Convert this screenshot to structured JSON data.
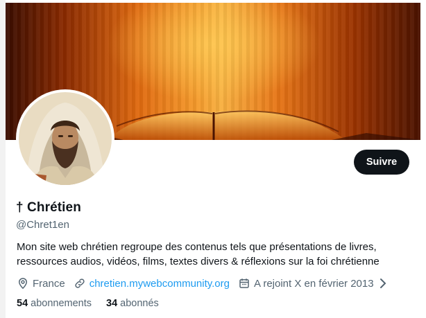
{
  "profile": {
    "name": "† Chrétien",
    "handle": "@Chret1en",
    "bio_lines": [
      "Mon site web chrétien regroupe des contenus tels que présentations de livres,",
      "ressources audios, vidéos, films, textes divers & réflexions sur la foi chrétienne"
    ],
    "location": "France",
    "website": "chretien.mywebcommunity.org",
    "joined": "A rejoint X en février 2013",
    "following_count": "54",
    "following_label": "abonnements",
    "followers_count": "34",
    "followers_label": "abonnés"
  },
  "actions": {
    "follow_label": "Suivre"
  },
  "icons": {
    "location": "location-pin-icon",
    "website": "link-icon",
    "joined": "calendar-icon",
    "joined_arrow": "chevron-right-icon"
  },
  "colors": {
    "accent": "#1d9bf0",
    "button_bg": "#0f1419",
    "muted_text": "#536471"
  }
}
